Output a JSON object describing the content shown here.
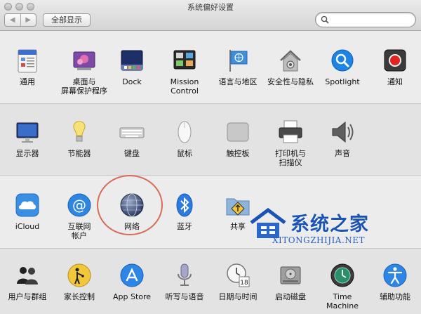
{
  "window": {
    "title": "系统偏好设置"
  },
  "toolbar": {
    "back": "◀",
    "forward": "▶",
    "show_all": "全部显示",
    "search_placeholder": ""
  },
  "sections": [
    {
      "items": [
        {
          "label": [
            "通用"
          ],
          "icon": "file-general-icon"
        },
        {
          "label": [
            "桌面与",
            "屏幕保护程序"
          ],
          "icon": "desktop-screensaver-icon"
        },
        {
          "label": [
            "Dock"
          ],
          "icon": "dock-icon"
        },
        {
          "label": [
            "Mission",
            "Control"
          ],
          "icon": "mission-control-icon"
        },
        {
          "label": [
            "语言与地区"
          ],
          "icon": "language-flag-icon"
        },
        {
          "label": [
            "安全性与隐私"
          ],
          "icon": "security-house-icon"
        },
        {
          "label": [
            "Spotlight"
          ],
          "icon": "spotlight-icon"
        },
        {
          "label": [
            "通知"
          ],
          "icon": "notifications-icon"
        }
      ]
    },
    {
      "items": [
        {
          "label": [
            "显示器"
          ],
          "icon": "display-icon"
        },
        {
          "label": [
            "节能器"
          ],
          "icon": "energy-saver-icon"
        },
        {
          "label": [
            "键盘"
          ],
          "icon": "keyboard-icon"
        },
        {
          "label": [
            "鼠标"
          ],
          "icon": "mouse-icon"
        },
        {
          "label": [
            "触控板"
          ],
          "icon": "trackpad-icon"
        },
        {
          "label": [
            "打印机与",
            "扫描仪"
          ],
          "icon": "printer-icon"
        },
        {
          "label": [
            "声音"
          ],
          "icon": "sound-icon"
        }
      ]
    },
    {
      "items": [
        {
          "label": [
            "iCloud"
          ],
          "icon": "icloud-icon"
        },
        {
          "label": [
            "互联网",
            "帐户"
          ],
          "icon": "internet-accounts-icon"
        },
        {
          "label": [
            "网络"
          ],
          "icon": "network-icon"
        },
        {
          "label": [
            "蓝牙"
          ],
          "icon": "bluetooth-icon"
        },
        {
          "label": [
            "共享"
          ],
          "icon": "sharing-icon"
        }
      ]
    },
    {
      "items": [
        {
          "label": [
            "用户与群组"
          ],
          "icon": "users-groups-icon"
        },
        {
          "label": [
            "家长控制"
          ],
          "icon": "parental-controls-icon"
        },
        {
          "label": [
            "App Store"
          ],
          "icon": "app-store-icon"
        },
        {
          "label": [
            "听写与语音"
          ],
          "icon": "dictation-mic-icon"
        },
        {
          "label": [
            "日期与时间"
          ],
          "icon": "date-time-icon"
        },
        {
          "label": [
            "启动磁盘"
          ],
          "icon": "startup-disk-icon"
        },
        {
          "label": [
            "Time Machine"
          ],
          "icon": "time-machine-icon"
        },
        {
          "label": [
            "辅助功能"
          ],
          "icon": "accessibility-icon"
        }
      ]
    }
  ],
  "watermark": {
    "name": "系统之家",
    "url": "XITONGZHIJIA.NET"
  },
  "colors": {
    "accent_blue": "#1d84e6",
    "highlight_ring": "#d86b55",
    "watermark_blue": "#1b52b6"
  }
}
